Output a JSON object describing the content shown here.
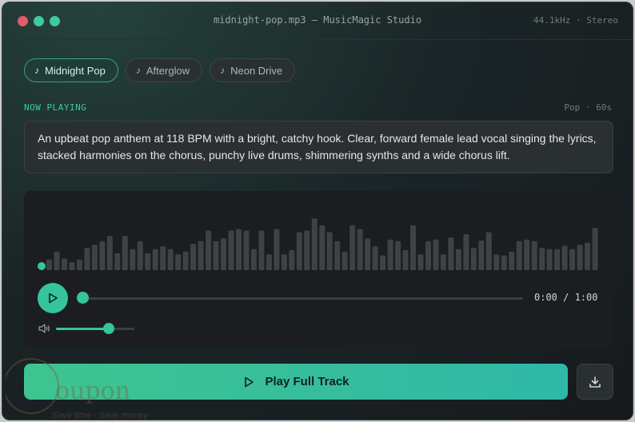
{
  "window": {
    "title": "midnight-pop.mp3 — MusicMagic Studio",
    "meta": "44.1kHz · Stereo"
  },
  "presets": [
    {
      "label": "Midnight Pop",
      "active": true
    },
    {
      "label": "Afterglow",
      "active": false
    },
    {
      "label": "Neon Drive",
      "active": false
    }
  ],
  "now_playing": {
    "label": "NOW PLAYING",
    "meta": "Pop · 60s",
    "description": "An upbeat pop anthem at 118 BPM with a bright, catchy hook. Clear, forward female lead vocal singing the lyrics, stacked harmonies on the chorus, punchy live drums, shimmering synths and a wide chorus lift."
  },
  "player": {
    "time": "0:00 / 1:00",
    "progress": 0,
    "volume": 0.67,
    "waveform": [
      0.2,
      0.35,
      0.22,
      0.15,
      0.2,
      0.42,
      0.48,
      0.55,
      0.65,
      0.32,
      0.65,
      0.4,
      0.55,
      0.32,
      0.4,
      0.45,
      0.4,
      0.3,
      0.35,
      0.5,
      0.55,
      0.75,
      0.55,
      0.6,
      0.75,
      0.78,
      0.75,
      0.4,
      0.75,
      0.3,
      0.78,
      0.3,
      0.38,
      0.72,
      0.75,
      0.98,
      0.85,
      0.72,
      0.55,
      0.35,
      0.85,
      0.78,
      0.6,
      0.45,
      0.28,
      0.58,
      0.55,
      0.38,
      0.85,
      0.3,
      0.55,
      0.58,
      0.3,
      0.62,
      0.4,
      0.68,
      0.42,
      0.56,
      0.72,
      0.3,
      0.28,
      0.35,
      0.55,
      0.58,
      0.55,
      0.42,
      0.4,
      0.4,
      0.46,
      0.4,
      0.48,
      0.52,
      0.8
    ]
  },
  "actions": {
    "play_full": "Play Full Track"
  },
  "watermark": {
    "brand": "oupon",
    "tagline": "Save time · Save money"
  },
  "colors": {
    "accent": "#35c49b",
    "bar": "#3e4246",
    "close": "#e5596c"
  },
  "icons": {
    "preset": "music-note-icon",
    "play": "play-icon",
    "volume": "volume-icon",
    "download": "download-icon"
  }
}
